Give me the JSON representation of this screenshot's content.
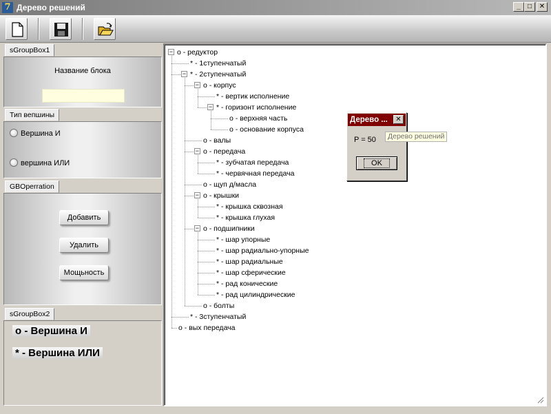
{
  "window": {
    "title": "Дерево решений"
  },
  "toolbar": {
    "buttons": [
      {
        "icon": "new-document-icon"
      },
      {
        "icon": "save-floppy-icon"
      },
      {
        "icon": "open-folder-icon"
      }
    ]
  },
  "groupbox1": {
    "tab": "sGroupBox1",
    "label": "Название блока",
    "field_value": ""
  },
  "vertex_type": {
    "tab": "Тип вепшины",
    "option_and": "Вершина И",
    "option_or": "вершина ИЛИ"
  },
  "operations": {
    "tab": "GBOperration",
    "add": "Добавить",
    "delete": "Удалить",
    "power": "Мощьность"
  },
  "groupbox2": {
    "tab": "sGroupBox2",
    "legend_and": "o - Вершина И",
    "legend_or": "* - Вершина ИЛИ"
  },
  "tree": {
    "nodes": [
      {
        "text": "o - редуктор",
        "level": 0,
        "expander": "minus"
      },
      {
        "text": "* - 1ступенчатый",
        "level": 1,
        "expander": ""
      },
      {
        "text": "* - 2ступенчатый",
        "level": 1,
        "expander": "minus"
      },
      {
        "text": "o - корпус",
        "level": 2,
        "expander": "minus"
      },
      {
        "text": "* - вертик исполнение",
        "level": 3,
        "expander": ""
      },
      {
        "text": "* - горизонт исполнение",
        "level": 3,
        "expander": "minus"
      },
      {
        "text": "o - верхняя часть",
        "level": 4,
        "expander": ""
      },
      {
        "text": "o - основание корпуса",
        "level": 4,
        "expander": ""
      },
      {
        "text": "o - валы",
        "level": 2,
        "expander": ""
      },
      {
        "text": "o - передача",
        "level": 2,
        "expander": "minus"
      },
      {
        "text": "* - зубчатая передача",
        "level": 3,
        "expander": ""
      },
      {
        "text": "* - червячная передача",
        "level": 3,
        "expander": ""
      },
      {
        "text": "o - щуп д/масла",
        "level": 2,
        "expander": ""
      },
      {
        "text": "o - крышки",
        "level": 2,
        "expander": "minus"
      },
      {
        "text": "* - крышка сквозная",
        "level": 3,
        "expander": ""
      },
      {
        "text": "* - крышка глухая",
        "level": 3,
        "expander": ""
      },
      {
        "text": "o - подшипники",
        "level": 2,
        "expander": "minus"
      },
      {
        "text": "* - шар упорные",
        "level": 3,
        "expander": ""
      },
      {
        "text": "* - шар радиально-упорные",
        "level": 3,
        "expander": ""
      },
      {
        "text": "* - шар радиальные",
        "level": 3,
        "expander": ""
      },
      {
        "text": "* - шар сферические",
        "level": 3,
        "expander": ""
      },
      {
        "text": "* - рад конические",
        "level": 3,
        "expander": ""
      },
      {
        "text": "* - рад цилиндрические",
        "level": 3,
        "expander": ""
      },
      {
        "text": "o - болты",
        "level": 2,
        "expander": ""
      },
      {
        "text": "* - 3ступенчатый",
        "level": 1,
        "expander": ""
      },
      {
        "text": "o - вых передача",
        "level": 0,
        "expander": ""
      }
    ]
  },
  "dialog": {
    "title": "Дерево ...",
    "message": "P = 50",
    "ok": "OK",
    "tooltip": "Дерево решений"
  }
}
